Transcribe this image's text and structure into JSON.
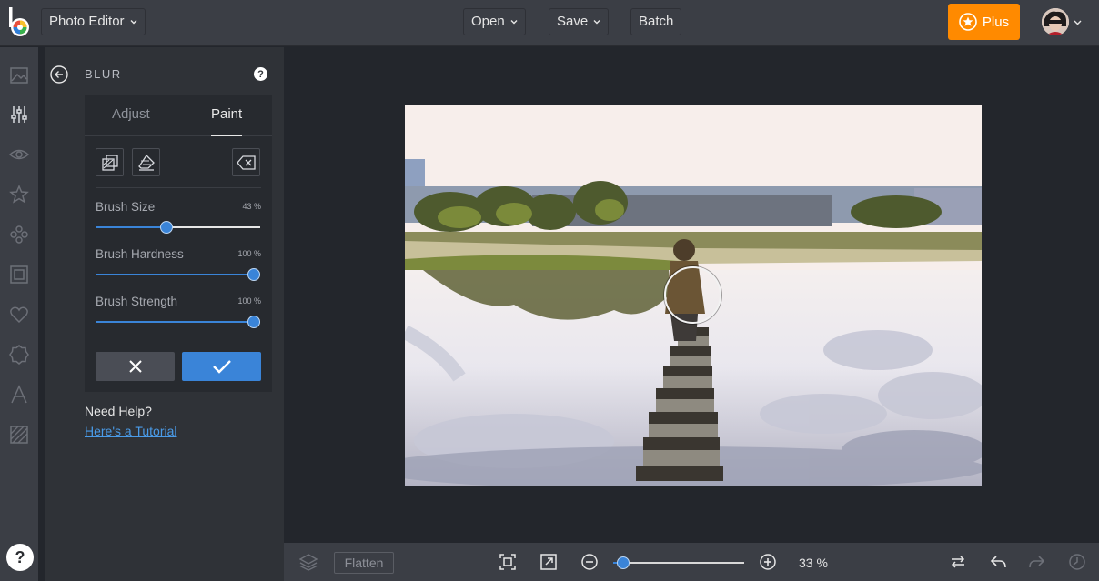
{
  "topbar": {
    "app_menu_label": "Photo Editor",
    "open_label": "Open",
    "save_label": "Save",
    "batch_label": "Batch",
    "plus_label": "Plus"
  },
  "rail": {
    "items": [
      "image-icon",
      "sliders-icon",
      "eye-icon",
      "star-icon",
      "effects-icon",
      "frame-icon",
      "heart-icon",
      "badge-icon",
      "text-icon",
      "texture-icon"
    ],
    "help_label": "?"
  },
  "panel": {
    "title": "BLUR",
    "help_label": "?",
    "tabs": [
      {
        "label": "Adjust"
      },
      {
        "label": "Paint"
      }
    ],
    "active_tab": "Paint",
    "sliders": [
      {
        "label": "Brush Size",
        "value": "43 %",
        "fraction": 0.43
      },
      {
        "label": "Brush Hardness",
        "value": "100 %",
        "fraction": 1.0
      },
      {
        "label": "Brush Strength",
        "value": "100 %",
        "fraction": 1.0
      }
    ],
    "need_help": "Need Help?",
    "tutorial_link": "Here's a Tutorial"
  },
  "bottombar": {
    "flatten_label": "Flatten",
    "zoom_value": "33 %",
    "zoom_fraction": 0.08
  },
  "colors": {
    "accent": "#3a84d8",
    "plus": "#ff8a00",
    "topbar": "#3b3e45",
    "panel": "#2f3237",
    "canvas": "#23262c"
  }
}
